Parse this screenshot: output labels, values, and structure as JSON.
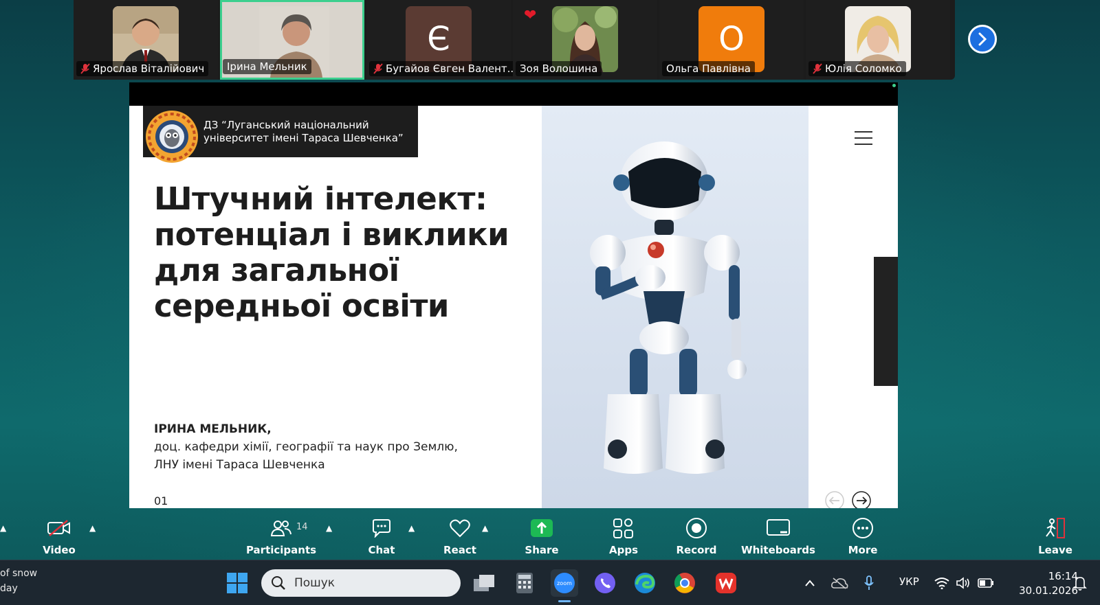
{
  "participants": [
    {
      "name": "Ярослав Віталійович",
      "muted": true,
      "active": false,
      "avatar": "photo"
    },
    {
      "name": "Ірина Мельник",
      "muted": false,
      "active": true,
      "avatar": "photo"
    },
    {
      "name": "Бугайов Євген Валент...",
      "muted": true,
      "active": false,
      "avatar": "letter",
      "letter": "Є",
      "color": "#5b3b33"
    },
    {
      "name": "Зоя Волошина",
      "muted": false,
      "active": false,
      "avatar": "photo"
    },
    {
      "name": "Ольга Павлівна",
      "muted": false,
      "active": false,
      "avatar": "letter",
      "letter": "О",
      "color": "#f07c0c"
    },
    {
      "name": "Юлія Соломко",
      "muted": true,
      "active": false,
      "avatar": "photo"
    }
  ],
  "slide": {
    "university": "ДЗ “Луганський національний університет імені Тараса Шевченка”",
    "title": "Штучний інтелект: потенціал і виклики для загальної середньої освіти",
    "author_name": "ІРИНА МЕЛЬНИК,",
    "author_line1": "доц. кафедри хімії, географії та наук про Землю,",
    "author_line2": "ЛНУ імені Тараса Шевченка",
    "number": "01"
  },
  "toolbar": {
    "video": "Video",
    "participants": "Participants",
    "participants_count": "14",
    "chat": "Chat",
    "react": "React",
    "share": "Share",
    "apps": "Apps",
    "record": "Record",
    "whiteboards": "Whiteboards",
    "more": "More",
    "leave": "Leave"
  },
  "taskbar": {
    "weather_line1": "of snow",
    "weather_line2": "day",
    "search_placeholder": "Пошук",
    "language": "УКР",
    "time": "16:14",
    "date": "30.01.2026"
  },
  "colors": {
    "share_green": "#1db954",
    "active_border": "#3ccf8e",
    "next_button": "#1c6fe0"
  }
}
